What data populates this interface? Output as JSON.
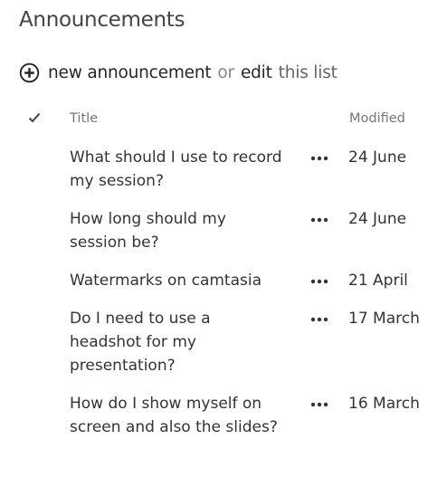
{
  "header": {
    "title": "Announcements"
  },
  "toolbar": {
    "new_label": "new announcement",
    "or_text": "or",
    "edit_label": "edit",
    "this_list_label": "this list"
  },
  "list": {
    "col_title": "Title",
    "col_modified": "Modified",
    "items": [
      {
        "title": "What should I use to record my session?",
        "modified": "24 June"
      },
      {
        "title": "How long should my session be?",
        "modified": "24 June"
      },
      {
        "title": "Watermarks on camtasia",
        "modified": "21 April"
      },
      {
        "title": "Do I need to use a headshot for my presentation?",
        "modified": "17 March"
      },
      {
        "title": "How do I show myself on screen and also the slides?",
        "modified": "16 March"
      }
    ]
  },
  "icons": {
    "add": "plus-circle-icon",
    "select_all": "checkmark-icon",
    "item_menu": "ellipsis-icon"
  }
}
